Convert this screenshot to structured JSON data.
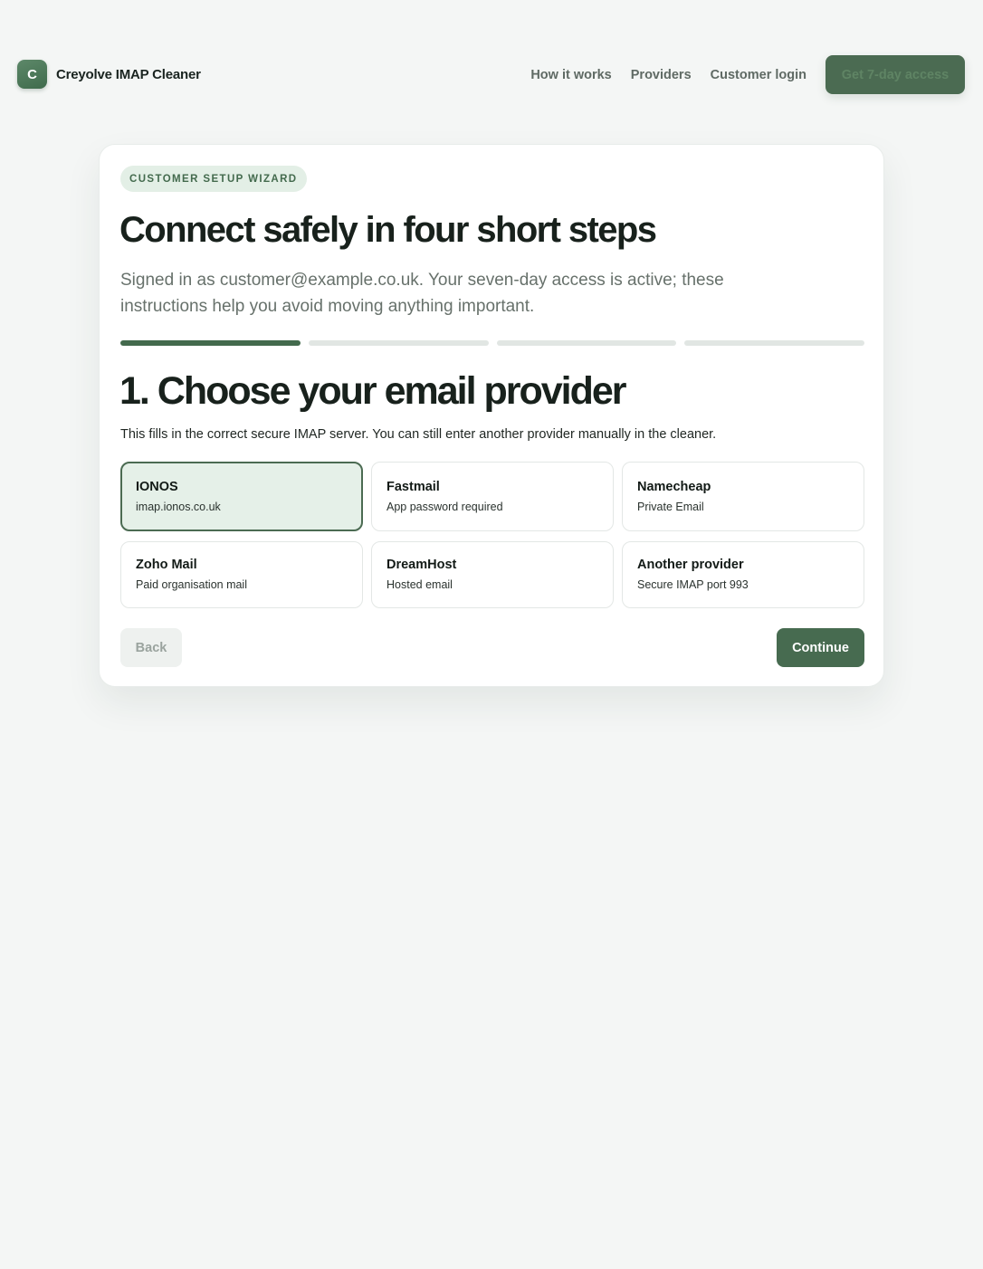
{
  "header": {
    "logo_letter": "C",
    "brand_name": "Creyolve IMAP Cleaner",
    "nav": [
      {
        "label": "How it works"
      },
      {
        "label": "Providers"
      },
      {
        "label": "Customer login"
      }
    ],
    "cta_label": "Get 7-day access"
  },
  "wizard": {
    "eyebrow": "CUSTOMER SETUP WIZARD",
    "title": "Connect safely in four short steps",
    "lead": "Signed in as customer@example.co.uk. Your seven-day access is active; these instructions help you avoid moving anything important.",
    "progress": {
      "current_step": 1,
      "total_steps": 4
    },
    "step_title": "1. Choose your email provider",
    "step_description": "This fills in the correct secure IMAP server. You can still enter another provider manually in the cleaner.",
    "providers": [
      {
        "name": "IONOS",
        "detail": "imap.ionos.co.uk",
        "selected": true
      },
      {
        "name": "Fastmail",
        "detail": "App password required",
        "selected": false
      },
      {
        "name": "Namecheap",
        "detail": "Private Email",
        "selected": false
      },
      {
        "name": "Zoho Mail",
        "detail": "Paid organisation mail",
        "selected": false
      },
      {
        "name": "DreamHost",
        "detail": "Hosted email",
        "selected": false
      },
      {
        "name": "Another provider",
        "detail": "Secure IMAP port 993",
        "selected": false
      }
    ],
    "back_label": "Back",
    "continue_label": "Continue"
  },
  "colors": {
    "accent": "#476b50",
    "accent_light": "#e5f0e8",
    "background": "#f4f6f5"
  }
}
